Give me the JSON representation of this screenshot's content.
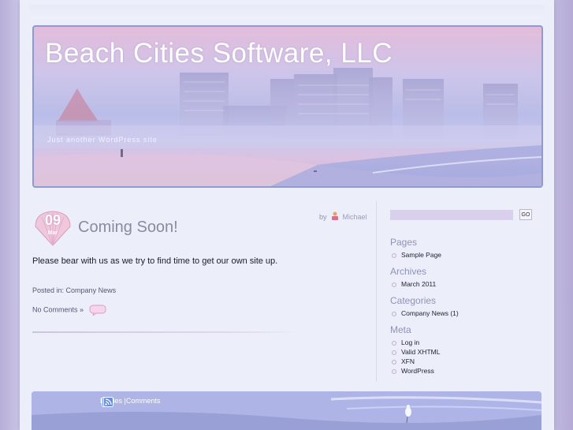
{
  "site": {
    "title": "Beach Cities Software, LLC",
    "tagline": "Just another WordPress site"
  },
  "post": {
    "date_day": "09",
    "date_month": "Mar",
    "title": "Coming Soon!",
    "by_label": "by",
    "author": "Michael",
    "body": "Please bear with us as we try to find time to get our own site up.",
    "posted_in_label": "Posted in:",
    "category": "Company News",
    "comments_label": "No Comments »"
  },
  "sidebar": {
    "search": {
      "value": "",
      "button": "GO"
    },
    "pages": {
      "title": "Pages",
      "items": [
        "Sample Page"
      ]
    },
    "archives": {
      "title": "Archives",
      "items": [
        "March 2011"
      ]
    },
    "categories": {
      "title": "Categories",
      "items": [
        "Company News (1)"
      ]
    },
    "meta": {
      "title": "Meta",
      "items": [
        "Log in",
        "Valid XHTML",
        "XFN",
        "WordPress"
      ]
    }
  },
  "footer": {
    "entries": "Entries",
    "separator": "|",
    "comments": "Comments"
  },
  "icons": {
    "author": "user-icon",
    "date": "shell-date-badge",
    "comments": "comment-bubble-icon",
    "feed": "rss-icon"
  },
  "colors": {
    "accent": "#8f93b6",
    "page_bg": "#eceefa",
    "header_border": "#8f9ad0"
  }
}
